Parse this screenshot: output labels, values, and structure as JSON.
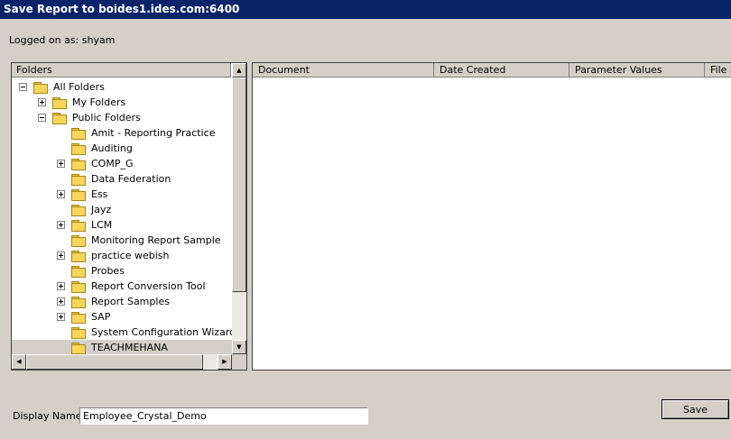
{
  "window": {
    "title": "Save Report to boides1.ides.com:6400"
  },
  "logged_on": "Logged on as: shyam",
  "tree": {
    "header": "Folders",
    "items": [
      {
        "label": "All Folders",
        "level": 0,
        "expander": "minus",
        "selected": false
      },
      {
        "label": "My Folders",
        "level": 1,
        "expander": "plus",
        "selected": false
      },
      {
        "label": "Public Folders",
        "level": 1,
        "expander": "minus",
        "selected": false
      },
      {
        "label": "Amit - Reporting Practice",
        "level": 2,
        "expander": "none",
        "selected": false
      },
      {
        "label": "Auditing",
        "level": 2,
        "expander": "none",
        "selected": false
      },
      {
        "label": "COMP_G",
        "level": 2,
        "expander": "plus",
        "selected": false
      },
      {
        "label": "Data Federation",
        "level": 2,
        "expander": "none",
        "selected": false
      },
      {
        "label": "Ess",
        "level": 2,
        "expander": "plus",
        "selected": false
      },
      {
        "label": "Jayz",
        "level": 2,
        "expander": "none",
        "selected": false
      },
      {
        "label": "LCM",
        "level": 2,
        "expander": "plus",
        "selected": false
      },
      {
        "label": "Monitoring Report Sample",
        "level": 2,
        "expander": "none",
        "selected": false
      },
      {
        "label": "practice webish",
        "level": 2,
        "expander": "plus",
        "selected": false
      },
      {
        "label": "Probes",
        "level": 2,
        "expander": "none",
        "selected": false
      },
      {
        "label": "Report Conversion Tool",
        "level": 2,
        "expander": "plus",
        "selected": false
      },
      {
        "label": "Report Samples",
        "level": 2,
        "expander": "plus",
        "selected": false
      },
      {
        "label": "SAP",
        "level": 2,
        "expander": "plus",
        "selected": false
      },
      {
        "label": "System Configuration Wizard",
        "level": 2,
        "expander": "none",
        "selected": false
      },
      {
        "label": "TEACHMEHANA",
        "level": 2,
        "expander": "none",
        "selected": true
      }
    ]
  },
  "doclist": {
    "columns": [
      "Document",
      "Date Created",
      "Parameter Values",
      "File S"
    ]
  },
  "display_name": {
    "label": "Display Name:",
    "value": "Employee_Crystal_Demo"
  },
  "buttons": {
    "save": "Save"
  },
  "scroll_glyphs": {
    "up": "▲",
    "down": "▼",
    "left": "◀",
    "right": "▶"
  }
}
